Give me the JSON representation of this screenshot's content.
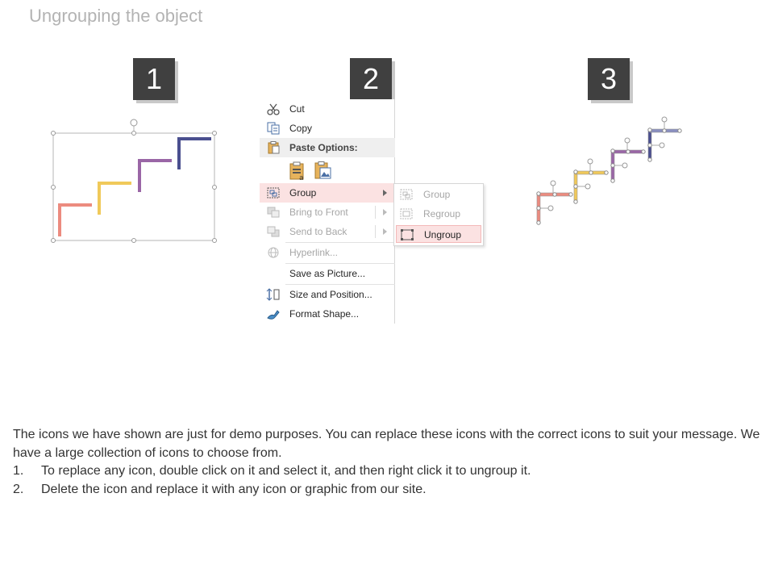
{
  "slide": {
    "title": "Ungrouping the object"
  },
  "steps": [
    "1",
    "2",
    "3"
  ],
  "colors": {
    "salmon": "#ec8b7f",
    "yellow": "#f0c95a",
    "purple": "#9a66a6",
    "navy": "#4a4f8f",
    "menu_highlight": "#fbe2e2"
  },
  "context_menu": {
    "items": [
      {
        "label": "Cut",
        "icon": "scissors-icon"
      },
      {
        "label": "Copy",
        "icon": "copy-icon"
      },
      {
        "label": "Paste Options:",
        "icon": "clipboard-icon"
      },
      {
        "label": "Group",
        "icon": "group-icon"
      },
      {
        "label": "Bring to Front",
        "icon": "bring-front-icon"
      },
      {
        "label": "Send to Back",
        "icon": "send-back-icon"
      },
      {
        "label": "Hyperlink...",
        "icon": "hyperlink-icon"
      },
      {
        "label": "Save as Picture...",
        "icon": ""
      },
      {
        "label": "Size and Position...",
        "icon": "size-position-icon"
      },
      {
        "label": "Format Shape...",
        "icon": "format-shape-icon"
      }
    ]
  },
  "submenu": {
    "items": [
      {
        "label": "Group",
        "icon": "group-icon"
      },
      {
        "label": "Regroup",
        "icon": "regroup-icon"
      },
      {
        "label": "Ungroup",
        "icon": "ungroup-icon"
      }
    ]
  },
  "description": {
    "intro": "The icons we have shown are just for demo purposes. You can replace these icons with the correct icons to suit your message. We have a large collection of icons to choose from.",
    "list": [
      {
        "num": "1.",
        "text": "To replace any icon, double click on it and select it, and then right click it to ungroup it."
      },
      {
        "num": "2.",
        "text": "Delete the icon and replace it with any icon or graphic from our site."
      }
    ]
  }
}
